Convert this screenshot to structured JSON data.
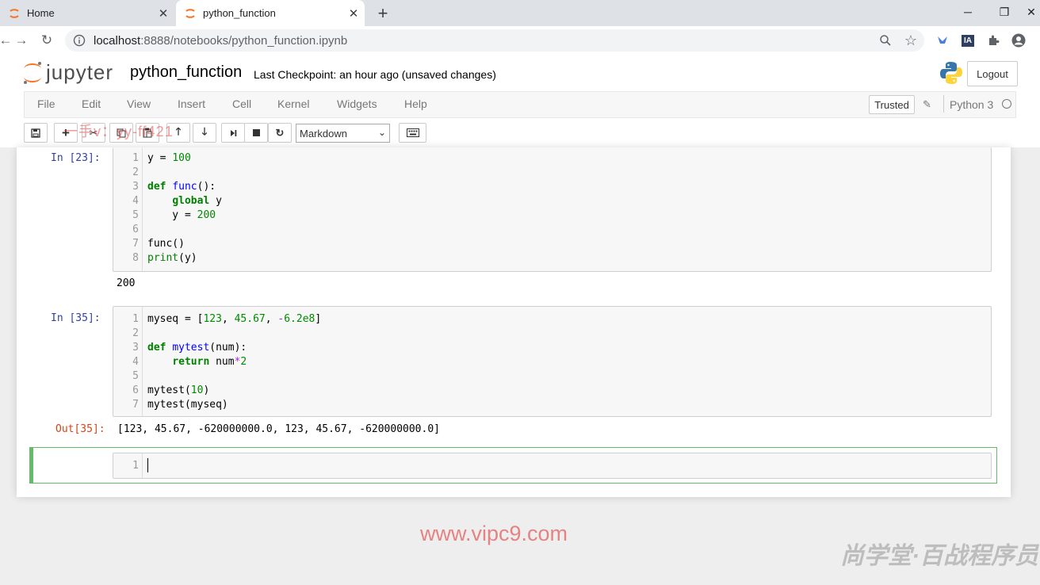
{
  "browser": {
    "tabs": [
      {
        "title": "Home"
      },
      {
        "title": "python_function"
      }
    ],
    "url_host": "localhost",
    "url_rest": ":8888/notebooks/python_function.ipynb",
    "window_buttons": {
      "minimize": "─",
      "restore": "❐",
      "close": "✕"
    }
  },
  "jupyter": {
    "logo_text": "jupyter",
    "notebook_name": "python_function",
    "checkpoint": "Last Checkpoint: an hour ago  (unsaved changes)",
    "logout_label": "Logout",
    "trusted_label": "Trusted",
    "kernel_name": "Python 3",
    "menu": [
      "File",
      "Edit",
      "View",
      "Insert",
      "Cell",
      "Kernel",
      "Widgets",
      "Help"
    ],
    "cell_type": "Markdown"
  },
  "cells": [
    {
      "prompt": "In  [23]:",
      "lines": [
        "1",
        "2",
        "3",
        "4",
        "5",
        "6",
        "7",
        "8"
      ],
      "output": "200"
    },
    {
      "prompt": "In  [35]:",
      "lines": [
        "1",
        "2",
        "3",
        "4",
        "5",
        "6",
        "7"
      ],
      "out_prompt": "Out[35]:",
      "output": "[123, 45.67, -620000000.0, 123, 45.67, -620000000.0]"
    },
    {
      "lines": [
        "1"
      ]
    }
  ],
  "watermarks": {
    "overlay": "一手v：yy-ff421",
    "site": "www.vipc9.com",
    "brand": "尚学堂·百战程序员"
  }
}
